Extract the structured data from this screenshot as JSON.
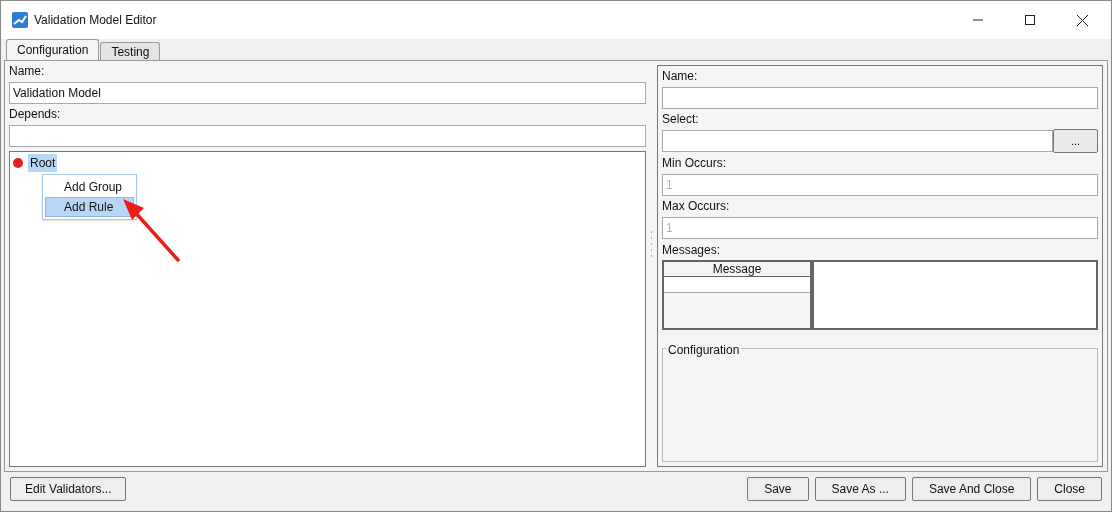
{
  "window": {
    "title": "Validation Model Editor"
  },
  "tabs": [
    {
      "label": "Configuration",
      "selected": true
    },
    {
      "label": "Testing",
      "selected": false
    }
  ],
  "left": {
    "name": {
      "label": "Name:",
      "value": "Validation Model"
    },
    "depends": {
      "label": "Depends:"
    },
    "tree": [
      {
        "label": "Root",
        "selected": true
      }
    ],
    "context_menu": [
      {
        "label": "Add Group",
        "selected": false
      },
      {
        "label": "Add Rule",
        "selected": true
      }
    ]
  },
  "right": {
    "name": {
      "label": "Name:"
    },
    "select": {
      "label": "Select:",
      "button": "..."
    },
    "min_occurs": {
      "label": "Min Occurs:",
      "value": "1",
      "disabled": true
    },
    "max_occurs": {
      "label": "Max Occurs:",
      "value": "1",
      "disabled": true
    },
    "messages": {
      "label": "Messages:",
      "column": "Message"
    },
    "configuration": {
      "title": "Configuration"
    }
  },
  "buttons_left": [
    "Edit Validators..."
  ],
  "buttons_right": [
    "Save",
    "Save As ...",
    "Save And Close",
    "Close"
  ]
}
